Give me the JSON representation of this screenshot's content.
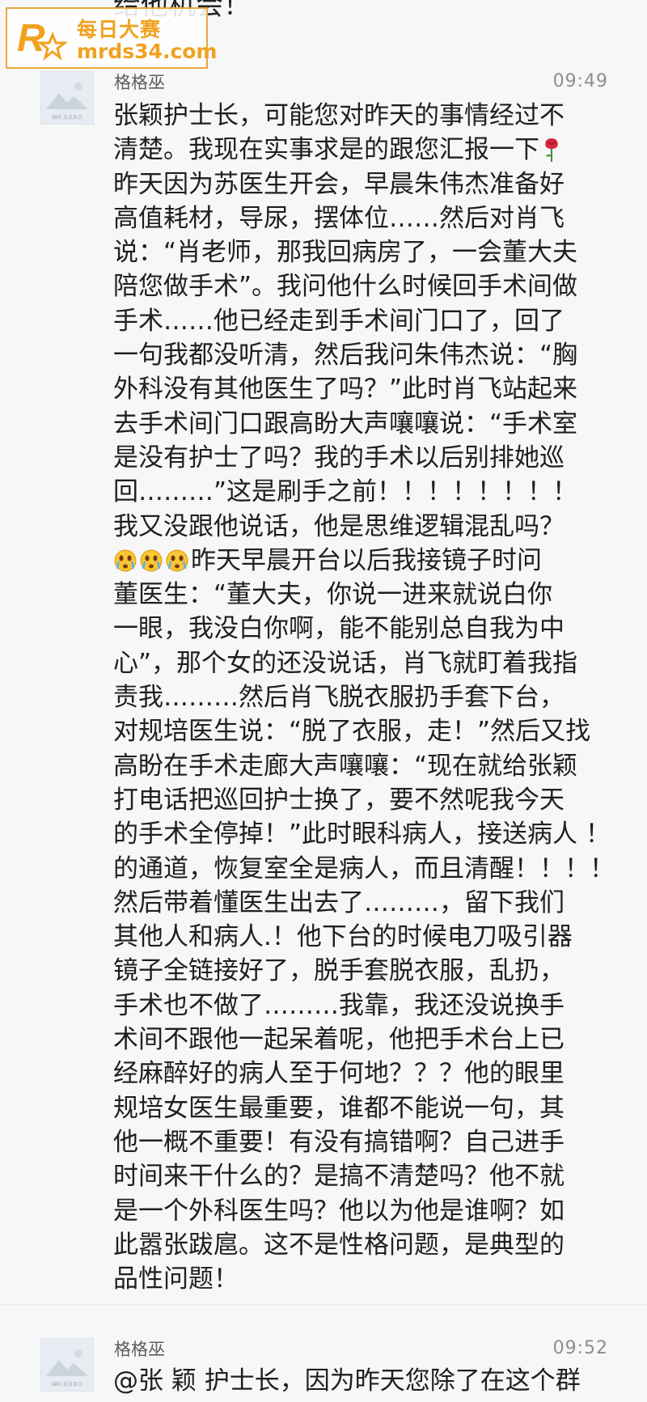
{
  "watermark": {
    "title": "每日大赛",
    "url": "mrds34.com",
    "badge_letter": "R",
    "badge_small": "每日大赛"
  },
  "previous_message": {
    "text_tail": "给他机会！"
  },
  "messages": [
    {
      "sender": "格格巫",
      "time": "09:49",
      "avatar_caption": "编码 无法显示",
      "lines": [
        "张颖护士长，可能您对昨天的事情经过不",
        "清楚。我现在实事求是的跟您汇报一下",
        "昨天因为苏医生开会，早晨朱伟杰准备好",
        "高值耗材，导尿，摆体位……然后对肖飞",
        "说：“肖老师，那我回病房了，一会董大夫",
        "陪您做手术”。我问他什么时候回手术间做",
        "手术……他已经走到手术间门口了，回了",
        "一句我都没听清，然后我问朱伟杰说：“胸",
        "外科没有其他医生了吗？”此时肖飞站起来",
        "去手术间门口跟高盼大声嚷嚷说：“手术室",
        "是没有护士了吗？我的手术以后别排她巡",
        "回………”这是刷手之前！！！！！！！！",
        "我又没跟他说话，他是思维逻辑混乱吗？",
        "昨天早晨开台以后我接镜子时问",
        "董医生：“董大夫，你说一进来就说白你",
        "一眼，我没白你啊，能不能别总自我为中",
        "心”，那个女的还没说话，肖飞就盯着我指",
        "责我………然后肖飞脱衣服扔手套下台，",
        "对规培医生说：“脱了衣服，走！”然后又找",
        "高盼在手术走廊大声嚷嚷：“现在就给张颖",
        "打电话把巡回护士换了，要不然呢我今天",
        "的手术全停掉！”此时眼科病人，接送病人 ！",
        "的通道，恢复室全是病人，而且清醒！！！！",
        "然后带着懂医生出去了………，留下我们",
        "其他人和病人.！他下台的时候电刀吸引器",
        "镜子全链接好了，脱手套脱衣服，乱扔，",
        "手术也不做了………我靠，我还没说换手",
        "术间不跟他一起呆着呢，他把手术台上已",
        "经麻醉好的病人至于何地？？？他的眼里",
        "规培女医生最重要，谁都不能说一句，其",
        "他一概不重要！有没有搞错啊？自己进手",
        "时间来干什么的？是搞不清楚吗？他不就",
        "是一个外科医生吗？他以为他是谁啊？如",
        "此嚣张跋扈。这不是性格问题，是典型的",
        "品性问题！"
      ],
      "emojis": [
        {
          "after_line": 1,
          "name": "rose-emoji"
        },
        {
          "before_line": 13,
          "name": "crying-face-emoji",
          "count": 3
        }
      ]
    },
    {
      "sender": "格格巫",
      "time": "09:52",
      "avatar_caption": "编码 无法显示",
      "lines": [
        "@张 颖 护士长，因为昨天您除了在这个群"
      ]
    }
  ],
  "colors": {
    "background": "#f7f7f7",
    "text": "#1f1f1f",
    "meta": "#8e8e8e",
    "watermark": "#f0a21f"
  }
}
